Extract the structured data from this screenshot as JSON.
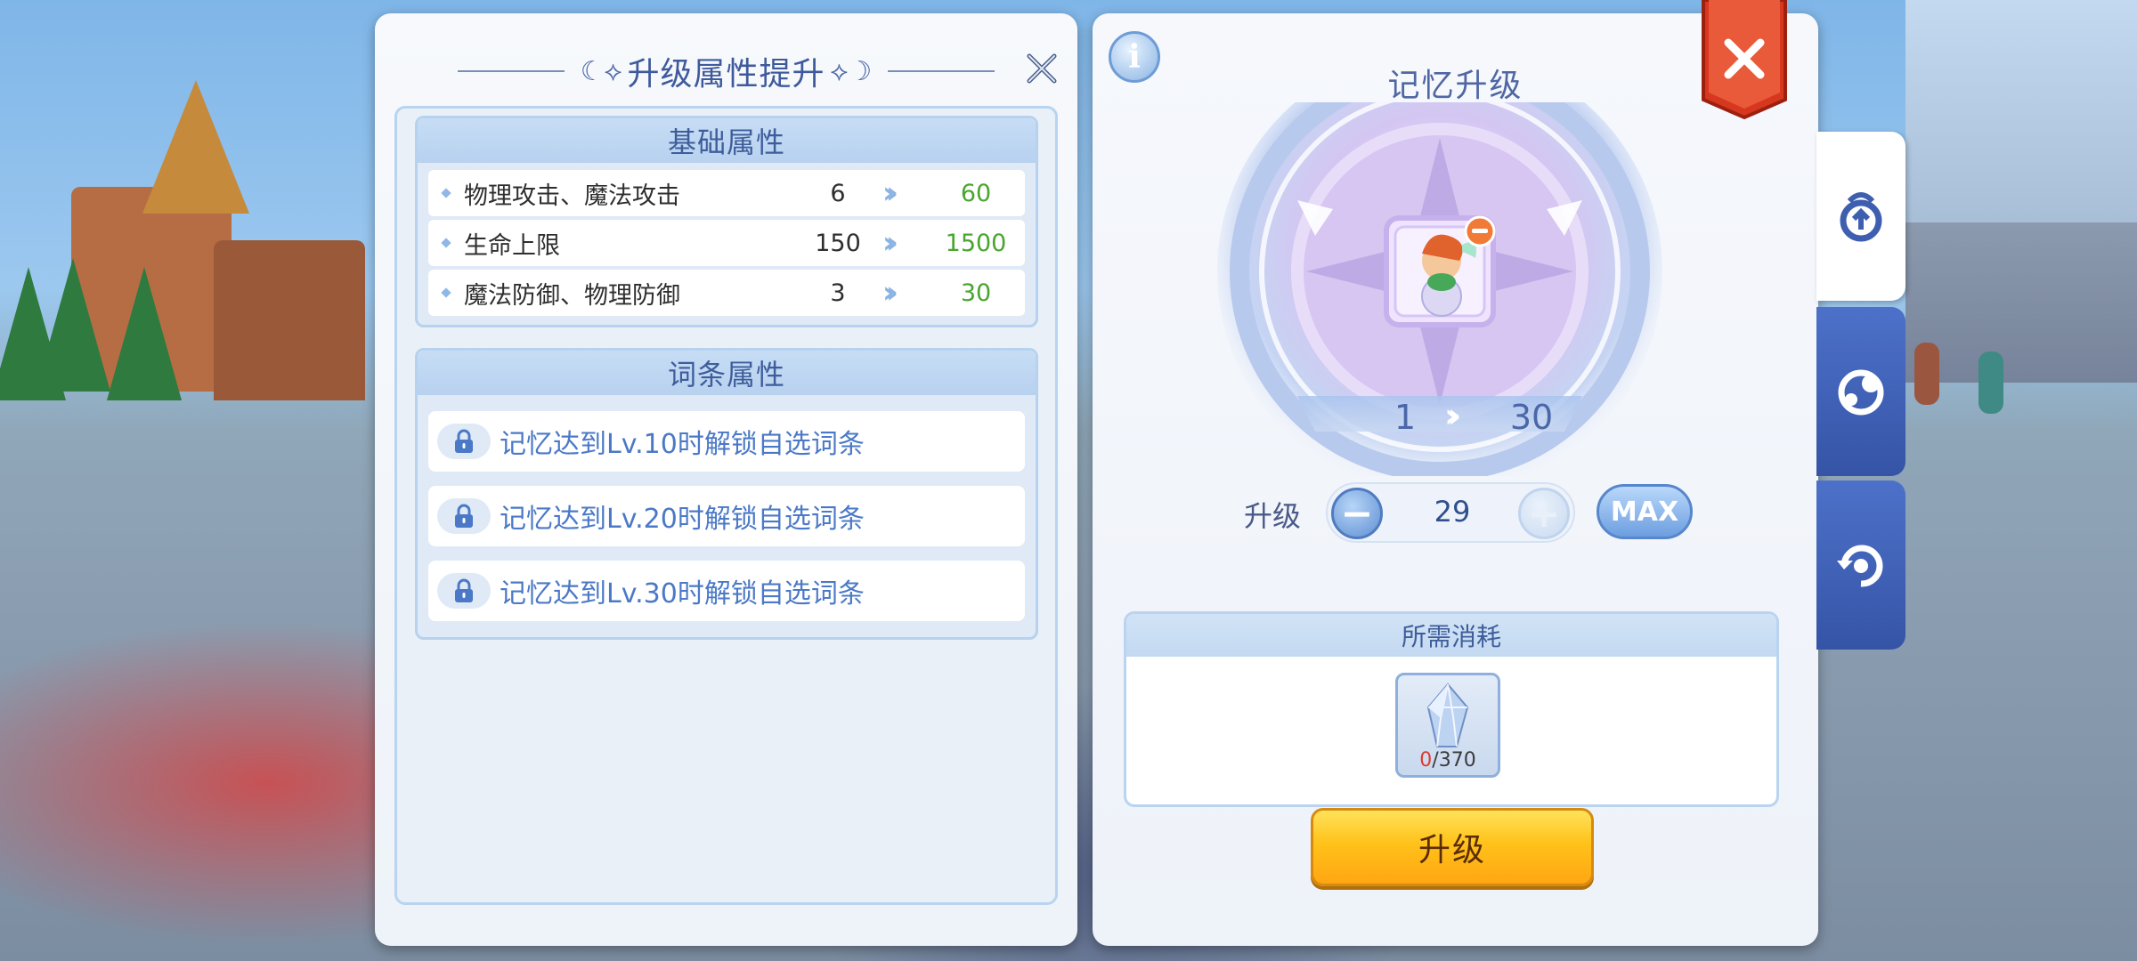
{
  "left_panel": {
    "title": "升级属性提升",
    "base_section": {
      "heading": "基础属性",
      "rows": [
        {
          "name": "物理攻击、魔法攻击",
          "from": "6",
          "to": "60"
        },
        {
          "name": "生命上限",
          "from": "150",
          "to": "1500"
        },
        {
          "name": "魔法防御、物理防御",
          "from": "3",
          "to": "30"
        }
      ]
    },
    "entry_section": {
      "heading": "词条属性",
      "locks": [
        {
          "text": "记忆达到Lv.10时解锁自选词条"
        },
        {
          "text": "记忆达到Lv.20时解锁自选词条"
        },
        {
          "text": "记忆达到Lv.30时解锁自选词条"
        }
      ]
    }
  },
  "right_panel": {
    "info_label": "i",
    "title": "记忆升级",
    "level_from": "1",
    "level_to": "30",
    "upgrade_label": "升级",
    "stepper_value": "29",
    "max_label": "MAX",
    "cost": {
      "heading": "所需消耗",
      "have": "0",
      "need": "/370"
    },
    "upgrade_button": "升级"
  },
  "colors": {
    "accent_blue": "#3e5d9b",
    "value_green": "#4aa52f",
    "close_red": "#e0422e",
    "button_yellow": "#ffc21a",
    "tab_blue": "#3554a6"
  },
  "icons": [
    "close-x-icon",
    "info-icon",
    "lock-icon",
    "minus-icon",
    "plus-icon",
    "crystal-icon",
    "memory-upgrade-tab-icon",
    "memory-swap-tab-icon",
    "memory-reset-tab-icon"
  ]
}
